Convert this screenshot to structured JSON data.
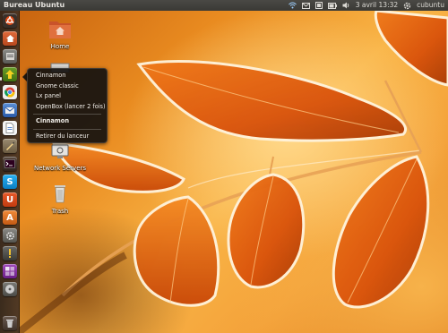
{
  "top_panel": {
    "title": "Bureau Ubuntu",
    "datetime": "3 avril  13:32",
    "user": "cubuntu",
    "indicators": [
      "network-icon",
      "mail-icon",
      "keyboard-layout-icon",
      "battery-icon",
      "volume-icon",
      "power-gear-icon"
    ]
  },
  "launcher": {
    "items": [
      {
        "name": "dash-home",
        "icon": "ubuntu-logo-icon"
      },
      {
        "name": "nautilus",
        "icon": "home-folder-icon"
      },
      {
        "name": "files",
        "icon": "file-manager-icon"
      },
      {
        "name": "session-switcher",
        "icon": "session-icon"
      },
      {
        "name": "chromium",
        "icon": "chromium-icon"
      },
      {
        "name": "thunderbird",
        "icon": "mail-client-icon"
      },
      {
        "name": "libreoffice-writer",
        "icon": "document-icon"
      },
      {
        "name": "libreoffice-draw",
        "icon": "draw-icon"
      },
      {
        "name": "terminal",
        "icon": "terminal-icon"
      },
      {
        "name": "skype",
        "icon": "skype-icon"
      },
      {
        "name": "ubuntu-one",
        "icon": "ubuntu-one-icon"
      },
      {
        "name": "software-center",
        "icon": "software-center-icon"
      },
      {
        "name": "system-settings",
        "icon": "settings-icon"
      },
      {
        "name": "system-monitor",
        "icon": "monitor-icon"
      },
      {
        "name": "workspace-switcher",
        "icon": "workspace-icon"
      },
      {
        "name": "cd-drive",
        "icon": "disc-icon"
      },
      {
        "name": "trash",
        "icon": "trash-icon"
      }
    ]
  },
  "desktop_icons": [
    {
      "label": "Home",
      "icon": "home-folder-icon"
    },
    {
      "label": "Network Servers",
      "icon": "network-servers-icon"
    },
    {
      "label": "Trash",
      "icon": "trash-icon"
    }
  ],
  "context_menu": {
    "items": [
      {
        "label": "Cinnamon",
        "bold": false
      },
      {
        "label": "Gnome classic",
        "bold": false
      },
      {
        "label": "Lx panel",
        "bold": false
      },
      {
        "label": "OpenBox (lancer 2 fois)",
        "bold": false
      },
      {
        "label": "Cinnamon",
        "bold": true
      },
      {
        "label": "Retirer du lanceur",
        "bold": false
      }
    ]
  },
  "colors": {
    "panel": "#3a3935",
    "accent_orange": "#dd4814",
    "menu_bg": "#141210"
  }
}
